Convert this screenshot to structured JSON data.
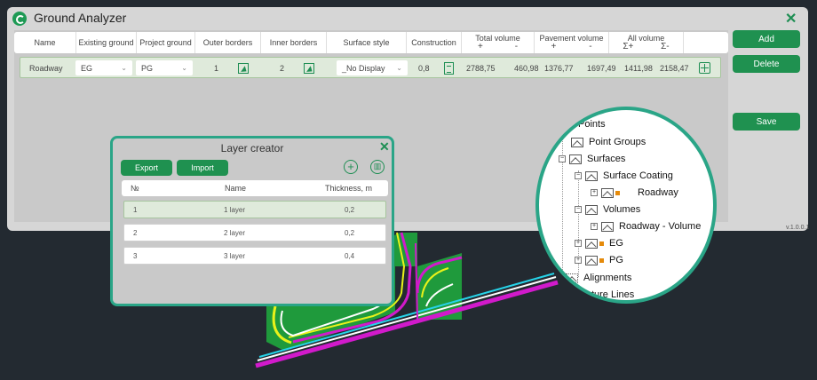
{
  "window": {
    "title": "Ground Analyzer",
    "version": "v.1.0.0.1"
  },
  "grid": {
    "columns": [
      {
        "label": "Name"
      },
      {
        "label": "Existing ground"
      },
      {
        "label": "Project ground"
      },
      {
        "label": "Outer borders"
      },
      {
        "label": "Inner borders"
      },
      {
        "label": "Surface style"
      },
      {
        "label": "Construction"
      },
      {
        "label": "Total volume",
        "sub": [
          "+",
          "-"
        ]
      },
      {
        "label": "Pavement volume",
        "sub": [
          "+",
          "-"
        ]
      },
      {
        "label": "All volume",
        "sub": [
          "Σ+",
          "Σ-"
        ]
      }
    ],
    "row": {
      "name": "Roadway",
      "existing_ground": "EG",
      "project_ground": "PG",
      "outer_borders": "1",
      "inner_borders": "2",
      "surface_style": "_No Display",
      "construction": "0,8",
      "total_plus": "2788,75",
      "total_minus": "460,98",
      "pavement_plus": "1376,77",
      "pavement_minus": "1697,49",
      "all_plus": "1411,98",
      "all_minus": "2158,47"
    }
  },
  "buttons": {
    "add": "Add",
    "delete": "Delete",
    "save": "Save"
  },
  "layer_creator": {
    "title": "Layer creator",
    "export": "Export",
    "import": "Import",
    "headers": {
      "num": "№",
      "name": "Name",
      "thickness": "Thickness, m"
    },
    "rows": [
      {
        "num": "1",
        "name": "1 layer",
        "thickness": "0,2"
      },
      {
        "num": "2",
        "name": "2 layer",
        "thickness": "0,2"
      },
      {
        "num": "3",
        "name": "3 layer",
        "thickness": "0,4"
      }
    ]
  },
  "tree": {
    "points": "Points",
    "point_groups": "Point Groups",
    "surfaces": "Surfaces",
    "surface_coating": "Surface Coating",
    "roadway": "Roadway",
    "volumes": "Volumes",
    "roadway_volume": "Roadway - Volume",
    "eg": "EG",
    "pg": "PG",
    "alignments": "Alignments",
    "feature_lines": "Feature Lines"
  },
  "colors": {
    "accent": "#1f9150",
    "callout": "#2aa587"
  }
}
